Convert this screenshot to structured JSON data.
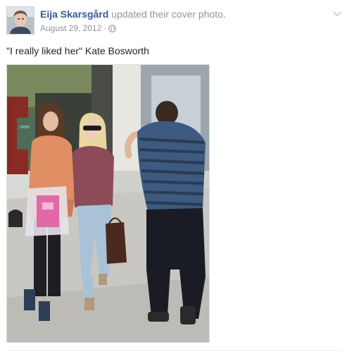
{
  "post": {
    "author_name": "Eija Skarsgård",
    "action_text": "updated their cover photo.",
    "date": "August 29, 2012",
    "separator": "·",
    "privacy_icon": "globe-icon",
    "options_icon": "chevron-down-icon",
    "message": "\"I really liked her\" Kate Bosworth",
    "photo_sign_text": "OPEN"
  },
  "colors": {
    "author_link": "#3b5998",
    "meta_text": "#90949c",
    "body_text": "#1d2129"
  }
}
